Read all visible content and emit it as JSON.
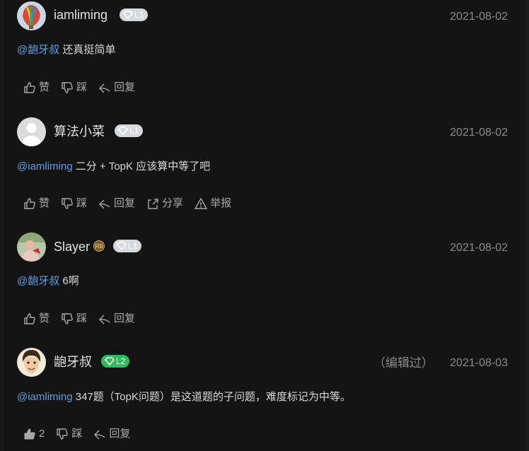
{
  "actions": {
    "like": "赞",
    "dislike": "踩",
    "reply": "回复",
    "share": "分享",
    "report": "举报"
  },
  "comments": [
    {
      "username": "iamliming",
      "level": "L1",
      "date": "2021-08-02",
      "mention": "@龅牙叔",
      "text": " 还真挺简单"
    },
    {
      "username": "算法小菜",
      "level": "L1",
      "date": "2021-08-02",
      "mention": "@iamliming",
      "text": " 二分 + TopK 应该算中等了吧"
    },
    {
      "username": "Slayer",
      "level": "L1",
      "date": "2021-08-02",
      "mention": "@龅牙叔",
      "text": " 6啊"
    },
    {
      "username": "龅牙叔",
      "level": "L2",
      "edited": "（编辑过）",
      "date": "2021-08-03",
      "mention": "@iamliming",
      "text": " 347题（TopK问题）是这道题的子问题，难度标记为中等。",
      "like_count": "2"
    }
  ],
  "colors": {
    "background": "#141414",
    "mention": "#5d9fe6",
    "badge_l1": "#d7d9de",
    "badge_l2": "#2cbd5a"
  }
}
